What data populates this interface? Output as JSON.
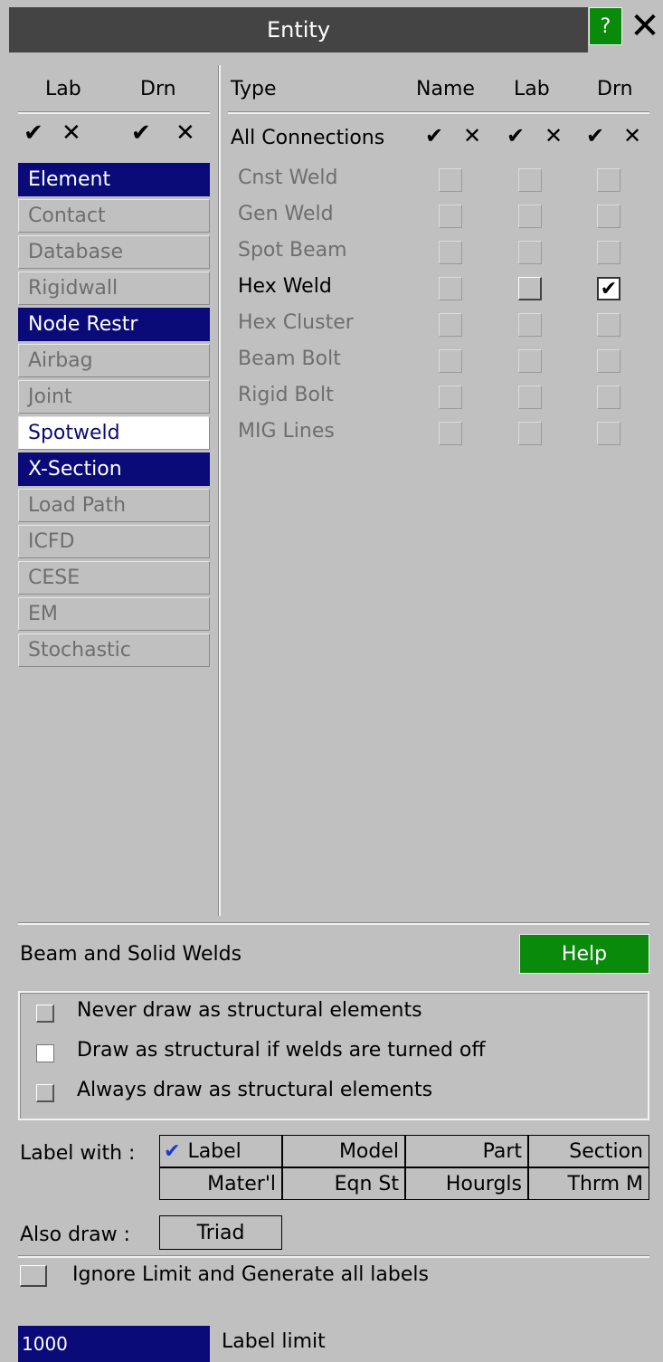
{
  "window": {
    "title": "Entity",
    "help_glyph": "?",
    "close_glyph": "✕"
  },
  "left_panel": {
    "header_lab": "Lab",
    "header_drn": "Drn",
    "tick_all": "✔",
    "cross_all": "✕",
    "items": [
      {
        "label": "Element",
        "state": "on"
      },
      {
        "label": "Contact",
        "state": "off"
      },
      {
        "label": "Database",
        "state": "off"
      },
      {
        "label": "Rigidwall",
        "state": "off"
      },
      {
        "label": "Node Restr",
        "state": "on"
      },
      {
        "label": "Airbag",
        "state": "off"
      },
      {
        "label": "Joint",
        "state": "off"
      },
      {
        "label": "Spotweld",
        "state": "current"
      },
      {
        "label": "X-Section",
        "state": "on"
      },
      {
        "label": "Load Path",
        "state": "off"
      },
      {
        "label": "ICFD",
        "state": "off"
      },
      {
        "label": "CESE",
        "state": "off"
      },
      {
        "label": "EM",
        "state": "off"
      },
      {
        "label": "Stochastic",
        "state": "off"
      }
    ]
  },
  "right_panel": {
    "col_type": "Type",
    "col_name": "Name",
    "col_lab": "Lab",
    "col_drn": "Drn",
    "all_connections": "All Connections",
    "tick": "✔",
    "cross": "✕",
    "check_mark": "✔",
    "rows": [
      {
        "label": "Cnst Weld",
        "enabled": false,
        "drn_checked": false
      },
      {
        "label": "Gen Weld",
        "enabled": false,
        "drn_checked": false
      },
      {
        "label": "Spot Beam",
        "enabled": false,
        "drn_checked": false
      },
      {
        "label": "Hex Weld",
        "enabled": true,
        "drn_checked": true
      },
      {
        "label": "Hex Cluster",
        "enabled": false,
        "drn_checked": false
      },
      {
        "label": "Beam Bolt",
        "enabled": false,
        "drn_checked": false
      },
      {
        "label": "Rigid Bolt",
        "enabled": false,
        "drn_checked": false
      },
      {
        "label": "MIG Lines",
        "enabled": false,
        "drn_checked": false
      }
    ]
  },
  "welds": {
    "title": "Beam and Solid Welds",
    "help_label": "Help",
    "options": [
      {
        "label": "Never draw as structural elements",
        "selected": false
      },
      {
        "label": "Draw as structural if welds are turned off",
        "selected": true
      },
      {
        "label": "Always draw as structural elements",
        "selected": false
      }
    ]
  },
  "label_with": {
    "label": "Label with :",
    "check_glyph": "✔",
    "row1": [
      "Label",
      "Model",
      "Part",
      "Section"
    ],
    "row2": [
      "Mater'l",
      "Eqn St",
      "Hourgls",
      "Thrm M"
    ]
  },
  "also_draw": {
    "label": "Also draw :",
    "triad": "Triad"
  },
  "ignore_limit": {
    "label": "Ignore Limit and Generate all labels"
  },
  "label_limit": {
    "value": "1000",
    "label": "Label limit"
  },
  "colors": {
    "selected_bg": "#0a0a78",
    "green_button": "#0a8a0a",
    "panel_bg": "#c0c0c0",
    "titlebar": "#444444"
  }
}
